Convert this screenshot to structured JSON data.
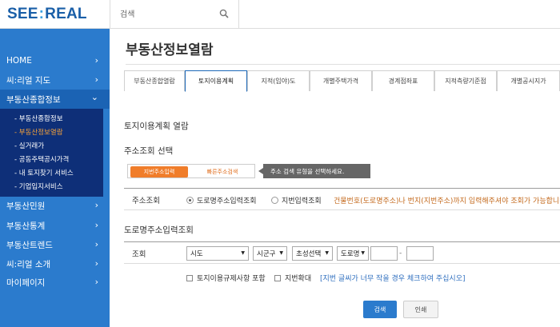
{
  "header": {
    "logo_left": "SEE",
    "logo_colon": ":",
    "logo_right": "REAL",
    "search_placeholder": "검색"
  },
  "sidebar": {
    "items": [
      {
        "label": "HOME",
        "chevron": "›"
      },
      {
        "label": "씨:리얼 지도",
        "chevron": "›"
      },
      {
        "label": "부동산종합정보",
        "chevron": "⌄"
      },
      {
        "label": "부동산민원",
        "chevron": "›"
      },
      {
        "label": "부동산통계",
        "chevron": "›"
      },
      {
        "label": "부동산트렌드",
        "chevron": "›"
      },
      {
        "label": "씨:리얼 소개",
        "chevron": "›"
      },
      {
        "label": "마이페이지",
        "chevron": "›"
      }
    ],
    "submenu": [
      "- 부동산종합정보",
      "- 부동산정보열람",
      "- 실거래가",
      "- 공동주택공시가격",
      "- 내 토지찾기 서비스",
      "- 기업입지서비스"
    ]
  },
  "main": {
    "title": "부동산정보열람",
    "tabs": [
      "부동산종합열람",
      "토지이용계획",
      "지적(임야)도",
      "개별주택가격",
      "경계점좌표",
      "지적측량기준점",
      "개별공시지가"
    ],
    "section_title": "토지이용계획 열람",
    "addr_section_title": "주소조회 선택",
    "toggle": {
      "on": "지번주소입력",
      "off": "빠른주소검색"
    },
    "tooltip": "주소 검색 유형을 선택하세요.",
    "addr_lookup": {
      "label": "주소조회",
      "radio1": "도로명주소입력조회",
      "radio2": "지번입력조회",
      "note": "건물번호(도로명주소)나 번지(지번주소)까지 입력해주셔야 조회가 가능합니다"
    },
    "road_section_title": "도로명주소입력조회",
    "lookup": {
      "label": "조회",
      "sido": "시도",
      "sigungu": "시군구",
      "choseong": "초성선택",
      "road": "도로명",
      "dash": "-"
    },
    "options": {
      "check1": "토지이용규제사항 포함",
      "check2": "지번확대",
      "hint": "[지번 글씨가 너무 작을 경우 체크하여 주십시오]"
    },
    "buttons": {
      "search": "검색",
      "print": "인쇄"
    }
  },
  "colors": {
    "sidebar": "#2b7bcd",
    "submenu": "#0e2f78",
    "accent_orange": "#f07d2a",
    "brand_blue": "#1a5fa8"
  }
}
